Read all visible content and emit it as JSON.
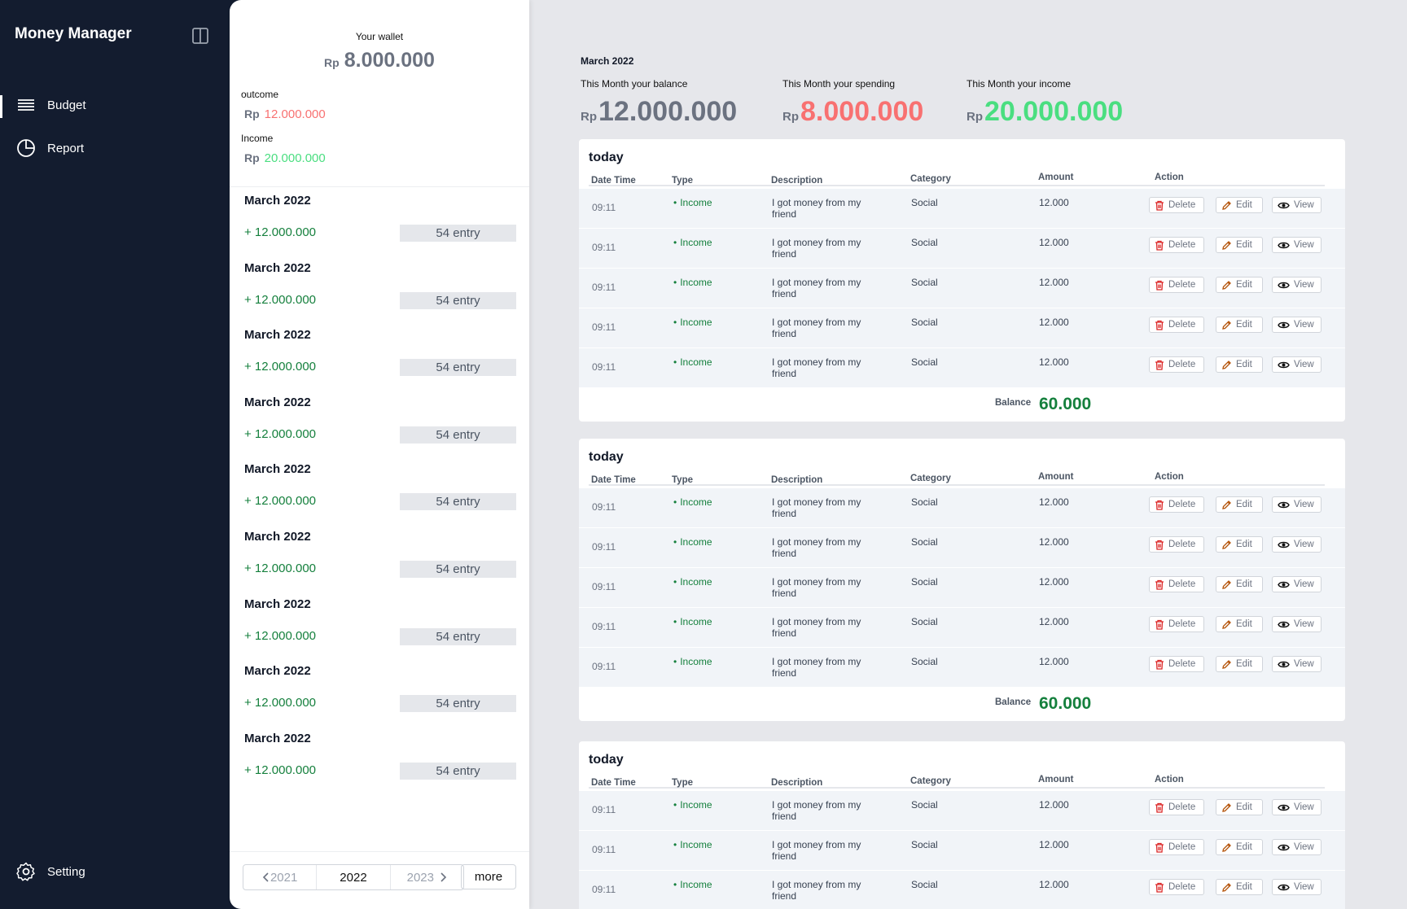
{
  "sidebar": {
    "app_title": "Money Manager",
    "nav": [
      {
        "label": "Budget",
        "icon": "list-icon",
        "active": true
      },
      {
        "label": "Report",
        "icon": "pie-chart-icon",
        "active": false
      }
    ],
    "setting_label": "Setting"
  },
  "wallet": {
    "title": "Your wallet",
    "currency": "Rp",
    "total": "8.000.000",
    "outcome_label": "outcome",
    "outcome_value": "12.000.000",
    "income_label": "Income",
    "income_value": "20.000.000",
    "months": [
      {
        "title": "March 2022",
        "amount": "+ 12.000.000",
        "entries": "54 entry"
      },
      {
        "title": "March 2022",
        "amount": "+ 12.000.000",
        "entries": "54 entry"
      },
      {
        "title": "March 2022",
        "amount": "+ 12.000.000",
        "entries": "54 entry"
      },
      {
        "title": "March 2022",
        "amount": "+ 12.000.000",
        "entries": "54 entry"
      },
      {
        "title": "March 2022",
        "amount": "+ 12.000.000",
        "entries": "54 entry"
      },
      {
        "title": "March 2022",
        "amount": "+ 12.000.000",
        "entries": "54 entry"
      },
      {
        "title": "March 2022",
        "amount": "+ 12.000.000",
        "entries": "54 entry"
      },
      {
        "title": "March 2022",
        "amount": "+ 12.000.000",
        "entries": "54 entry"
      },
      {
        "title": "March 2022",
        "amount": "+ 12.000.000",
        "entries": "54 entry"
      }
    ],
    "years": {
      "prev": "2021",
      "current": "2022",
      "next": "2023"
    },
    "more_label": "more"
  },
  "summary": {
    "month": "March 2022",
    "balance_label": "This Month your balance",
    "balance_value": "12.000.000",
    "spending_label": "This Month your spending",
    "spending_value": "8.000.000",
    "income_label": "This Month your income",
    "income_value": "20.000.000",
    "currency": "Rp"
  },
  "columns": {
    "datetime": "Date Time",
    "type": "Type",
    "description": "Description",
    "category": "Category",
    "amount": "Amount",
    "action": "Action"
  },
  "actions": {
    "delete": "Delete",
    "edit": "Edit",
    "view": "View"
  },
  "balance_label": "Balance",
  "groups": [
    {
      "title": "today",
      "balance": "60.000",
      "rows": [
        {
          "time": "09:11",
          "type": "Income",
          "description": "I got money from my friend",
          "category": "Social",
          "amount": "12.000"
        },
        {
          "time": "09:11",
          "type": "Income",
          "description": "I got money from my friend",
          "category": "Social",
          "amount": "12.000"
        },
        {
          "time": "09:11",
          "type": "Income",
          "description": "I got money from my friend",
          "category": "Social",
          "amount": "12.000"
        },
        {
          "time": "09:11",
          "type": "Income",
          "description": "I got money from my friend",
          "category": "Social",
          "amount": "12.000"
        },
        {
          "time": "09:11",
          "type": "Income",
          "description": "I got money from my friend",
          "category": "Social",
          "amount": "12.000"
        }
      ]
    },
    {
      "title": "today",
      "balance": "60.000",
      "rows": [
        {
          "time": "09:11",
          "type": "Income",
          "description": "I got money from my friend",
          "category": "Social",
          "amount": "12.000"
        },
        {
          "time": "09:11",
          "type": "Income",
          "description": "I got money from my friend",
          "category": "Social",
          "amount": "12.000"
        },
        {
          "time": "09:11",
          "type": "Income",
          "description": "I got money from my friend",
          "category": "Social",
          "amount": "12.000"
        },
        {
          "time": "09:11",
          "type": "Income",
          "description": "I got money from my friend",
          "category": "Social",
          "amount": "12.000"
        },
        {
          "time": "09:11",
          "type": "Income",
          "description": "I got money from my friend",
          "category": "Social",
          "amount": "12.000"
        }
      ]
    },
    {
      "title": "today",
      "balance": "",
      "rows": [
        {
          "time": "09:11",
          "type": "Income",
          "description": "I got money from my friend",
          "category": "Social",
          "amount": "12.000"
        },
        {
          "time": "09:11",
          "type": "Income",
          "description": "I got money from my friend",
          "category": "Social",
          "amount": "12.000"
        },
        {
          "time": "09:11",
          "type": "Income",
          "description": "I got money from my friend",
          "category": "Social",
          "amount": "12.000"
        }
      ]
    }
  ]
}
